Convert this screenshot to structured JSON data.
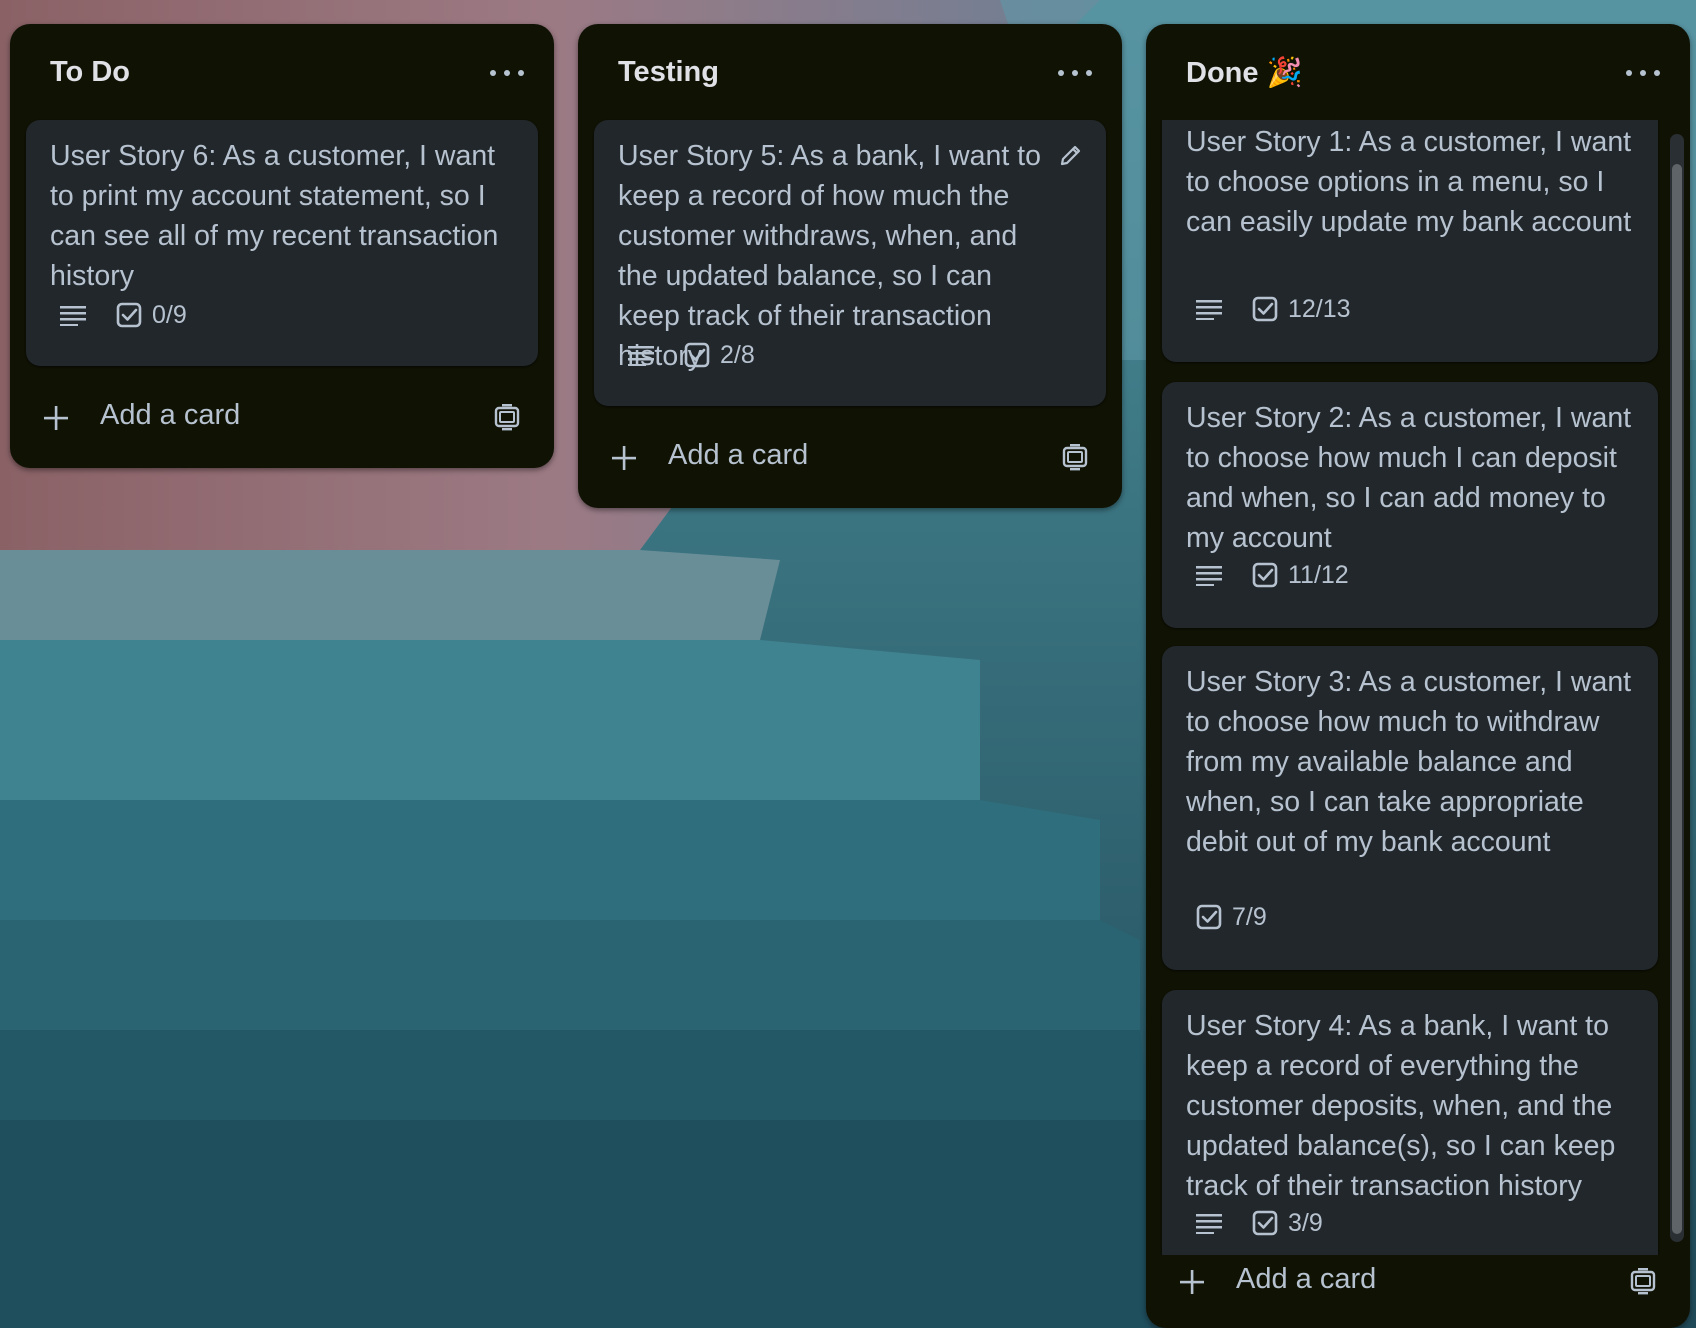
{
  "board": {
    "lists": [
      {
        "title": "To Do",
        "add_card_label": "Add a card",
        "cards": [
          {
            "title": "User Story 6: As a customer, I want to print my account statement, so I can see all of my recent transaction history",
            "checklist": "0/9",
            "has_description": true
          }
        ]
      },
      {
        "title": "Testing",
        "add_card_label": "Add a card",
        "cards": [
          {
            "title": "User Story 5: As a bank, I want to keep a record of how much the customer withdraws, when, and the updated balance, so I can keep track of their transaction history",
            "checklist": "2/8",
            "has_description": true
          }
        ]
      },
      {
        "title": "Done 🎉",
        "add_card_label": "Add a card",
        "cards": [
          {
            "title": "User Story 1: As a customer, I want to choose options in a menu, so I can easily update my bank account",
            "checklist": "12/13",
            "has_description": true
          },
          {
            "title": "User Story 2: As a customer, I want to choose how much I can deposit and when, so I can add money to my account",
            "checklist": "11/12",
            "has_description": true
          },
          {
            "title": "User Story 3: As a customer, I want to choose how much to withdraw from my available balance and when, so I can take appropriate debit out of my bank account",
            "checklist": "7/9",
            "has_description": false
          },
          {
            "title": "User Story 4: As a bank, I want to keep a record of everything the customer deposits, when, and the updated balance(s), so I can keep track of their transaction history",
            "checklist": "3/9",
            "has_description": true
          }
        ]
      }
    ]
  },
  "icons": {
    "list_menu": "more-horizontal-icon",
    "description": "description-lines-icon",
    "checklist": "checkbox-icon",
    "add": "plus-icon",
    "template": "card-template-icon",
    "edit": "pencil-icon"
  }
}
